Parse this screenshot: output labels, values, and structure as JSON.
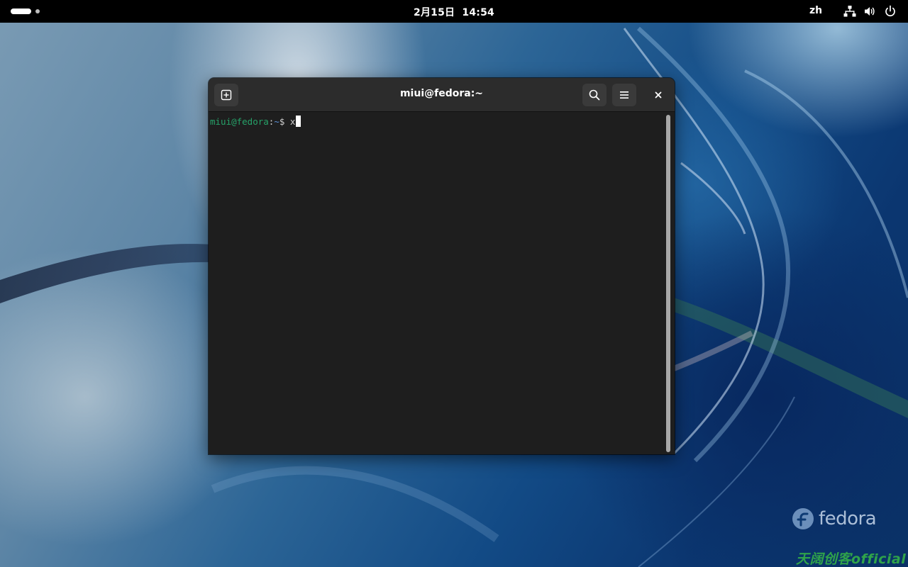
{
  "topbar": {
    "clock_date": "2月15日",
    "clock_time": "14:54",
    "language": "zh",
    "icons": [
      "network-icon",
      "volume-icon",
      "power-icon"
    ]
  },
  "terminal": {
    "title": "miui@fedora:~",
    "prompt_user": "miui@fedora",
    "prompt_colon": ":",
    "prompt_path": "~",
    "prompt_symbol": "$ ",
    "typed_text": "x",
    "buttons": {
      "new_tab": "new-tab-icon",
      "search": "search-icon",
      "menu": "menu-icon",
      "close": "close-icon"
    }
  },
  "desktop": {
    "logo_text": "fedora",
    "watermark": "天阔创客official"
  },
  "colors": {
    "topbar_bg": "#000000",
    "terminal_bg": "#1e1e1e",
    "headerbar_bg": "#2c2c2c",
    "prompt_user": "#26a269",
    "prompt_path": "#5a8fd6",
    "watermark": "#2fa34a"
  }
}
